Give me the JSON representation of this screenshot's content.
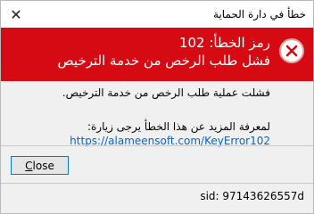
{
  "window": {
    "title": "خطأ في دارة الحماية",
    "close_glyph": "✕"
  },
  "banner": {
    "error_code_line": "رمز الخطأ: 102",
    "error_summary": "فشل طلب الرخص من خدمة الترخيص",
    "icon": "error-x-icon",
    "background_color": "#d60a12"
  },
  "body": {
    "message": "فشلت عملية طلب الرخص من خدمة الترخيص.",
    "info_prompt": "لمعرفة المزيد عن هذا الخطأ يرجى زيارة:",
    "link_url": "https://alameensoft.com/KeyError102",
    "link_color": "#0066cc"
  },
  "footer": {
    "close_button_label": "Close",
    "sid_text": "sid: 97143626557d"
  }
}
